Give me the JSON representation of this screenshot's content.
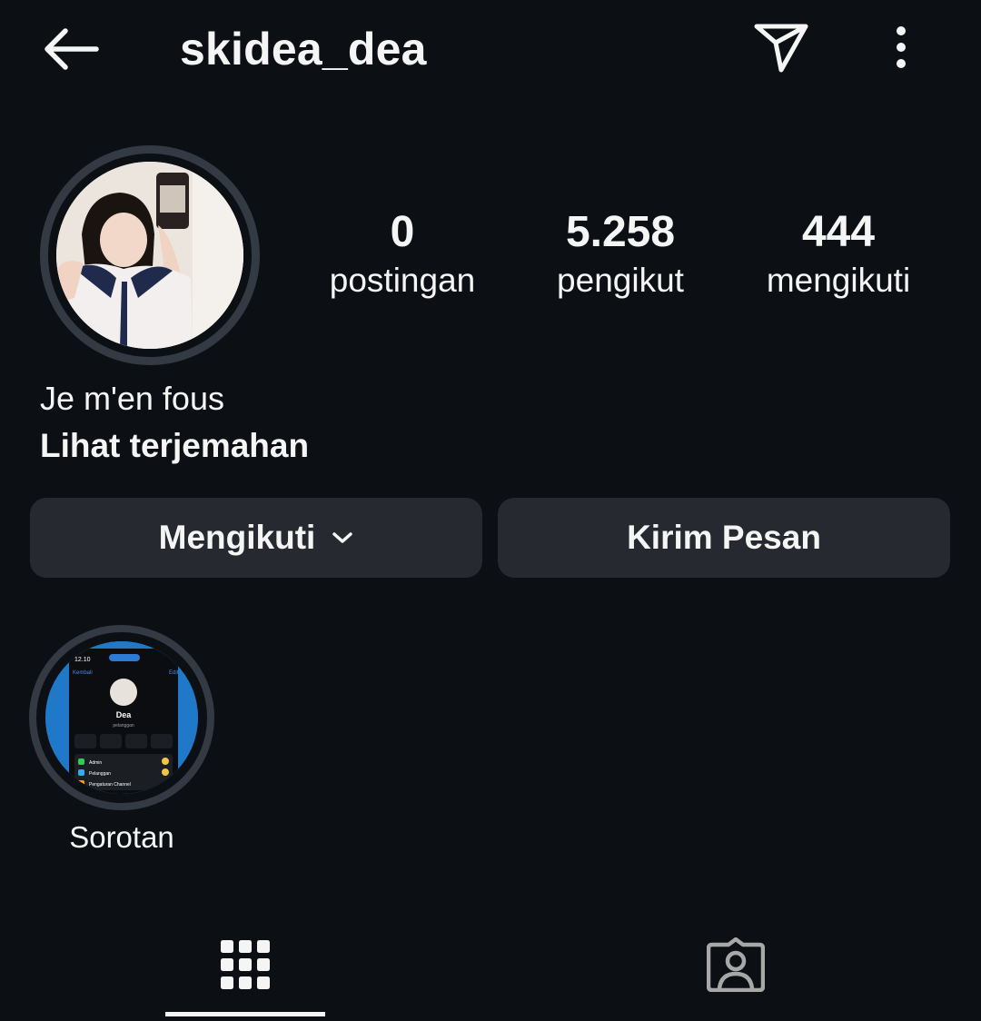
{
  "header": {
    "username": "skidea_dea",
    "back_icon": "arrow-left-icon",
    "send_icon": "paper-plane-icon",
    "more_icon": "more-vertical-icon"
  },
  "stats": [
    {
      "value": "0",
      "label": "postingan"
    },
    {
      "value": "5.258",
      "label": "pengikut"
    },
    {
      "value": "444",
      "label": "mengikuti"
    }
  ],
  "bio": {
    "text": "Je m'en fous",
    "translate_label": "Lihat terjemahan"
  },
  "actions": {
    "follow_label": "Mengikuti",
    "message_label": "Kirim Pesan"
  },
  "highlights": [
    {
      "label": "Sorotan",
      "thumb": {
        "time": "12.10",
        "back": "Kembali",
        "edit": "Edit",
        "name": "Dea",
        "handle": "pelanggan",
        "rows": [
          "Admin",
          "Pelanggan",
          "Pengaturan Channel"
        ]
      }
    }
  ],
  "tabs": [
    {
      "name": "posts-grid",
      "icon": "grid-icon",
      "active": true
    },
    {
      "name": "tagged",
      "icon": "tagged-person-icon",
      "active": false
    }
  ],
  "colors": {
    "background": "#0c1014",
    "button": "#262a30",
    "ring": "#333a44",
    "text": "#f5f5f5"
  }
}
